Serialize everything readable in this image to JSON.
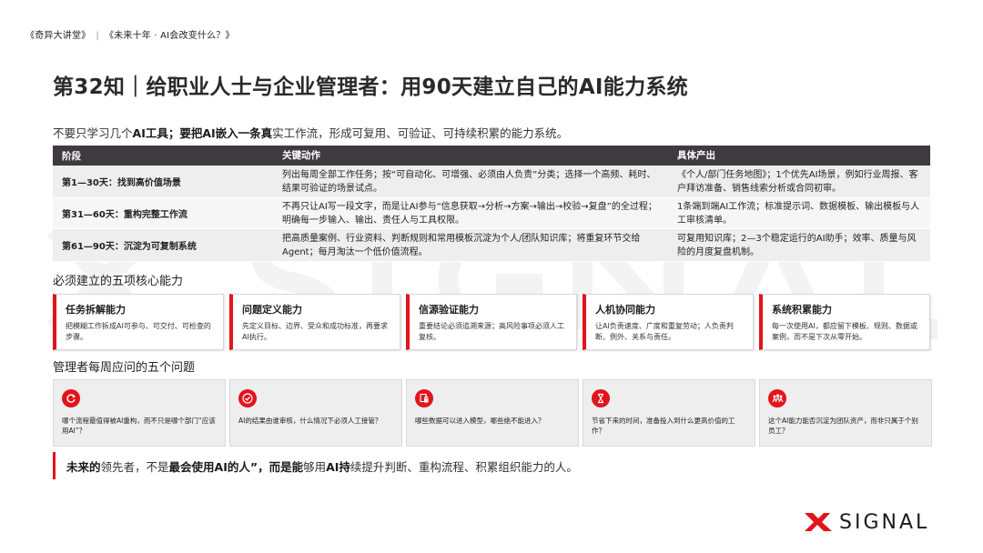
{
  "header": {
    "part1": "《奇异大讲堂》",
    "sep": "|",
    "part2": "《未来十年 · AI会改变什么？》"
  },
  "title": "第32知｜给职业人士与企业管理者：用90天建立自己的AI能力系统",
  "subtitle": {
    "pre": "不要只学习几个",
    "b1": "AI工具；要把AI嵌入一条真",
    "post": "实工作流，形成可复用、可验证、可持续积累的能力系统。"
  },
  "table": {
    "headers": [
      "阶段",
      "关键动作",
      "具体产出"
    ],
    "rows": [
      {
        "stage": "第1—30天：找到高价值场景",
        "action": "列出每周全部工作任务；按“可自动化、可增强、必须由人负责”分类；选择一个高频、耗时、结果可验证的场景试点。",
        "output": "《个人/部门任务地图》；1个优先AI场景，例如行业周报、客户拜访准备、销售线索分析或合同初审。"
      },
      {
        "stage": "第31—60天：重构完整工作流",
        "action": "不再只让AI写一段文字，而是让AI参与“信息获取→分析→方案→输出→校验→复盘”的全过程；明确每一步输入、输出、责任人与工具权限。",
        "output": "1条端到端AI工作流；标准提示词、数据模板、输出模板与人工审核清单。"
      },
      {
        "stage": "第61—90天：沉淀为可复制系统",
        "action": "把高质量案例、行业资料、判断规则和常用模板沉淀为个人/团队知识库；将重复环节交给Agent；每月淘汰一个低价值流程。",
        "output": "可复用知识库；2—3个稳定运行的AI助手；效率、质量与风险的月度复盘机制。"
      }
    ]
  },
  "capabilities_title": "必须建立的五项核心能力",
  "capabilities": [
    {
      "title": "任务拆解能力",
      "desc": "把模糊工作拆成AI可参与、可交付、可检查的步骤。"
    },
    {
      "title": "问题定义能力",
      "desc": "先定义目标、边界、受众和成功标准，再要求AI执行。"
    },
    {
      "title": "信源验证能力",
      "desc": "重要结论必须追溯来源；高风险事项必须人工复核。"
    },
    {
      "title": "人机协同能力",
      "desc": "让AI负责速度、广度和重复劳动；人负责判断、例外、关系与责任。"
    },
    {
      "title": "系统积累能力",
      "desc": "每一次使用AI，都应留下模板、规则、数据或案例，而不是下次从零开始。"
    }
  ],
  "questions_title": "管理者每周应问的五个问题",
  "questions": [
    {
      "icon": "refresh-cycle-icon",
      "text": "哪个流程最值得被AI重构，而不只是哪个部门“应该用AI”？"
    },
    {
      "icon": "check-circle-icon",
      "text": "AI的结果由谁审核，什么情况下必须人工接管？"
    },
    {
      "icon": "data-lock-icon",
      "text": "哪些数据可以进入模型，哪些绝不能进入？"
    },
    {
      "icon": "hourglass-icon",
      "text": "节省下来的时间，准备投入到什么更高价值的工作？"
    },
    {
      "icon": "team-network-icon",
      "text": "这个AI能力能否沉淀为团队资产，而非只属于个别员工？"
    }
  ],
  "quote": {
    "p1": "未来的",
    "p2": "领先者，不是",
    "b1": "最会使用AI的人”，而是能",
    "p3": "够用",
    "b2": "AI持",
    "p4": "续提升判断、重构流程、积累组织能力的人。"
  },
  "logo": {
    "text": "SIGNAL",
    "icon": "x-logo-icon"
  },
  "colors": {
    "accent": "#e2141c",
    "table_header": "#3f3a40",
    "row_bg": "#eeeeee",
    "text": "#1a1a1a"
  }
}
